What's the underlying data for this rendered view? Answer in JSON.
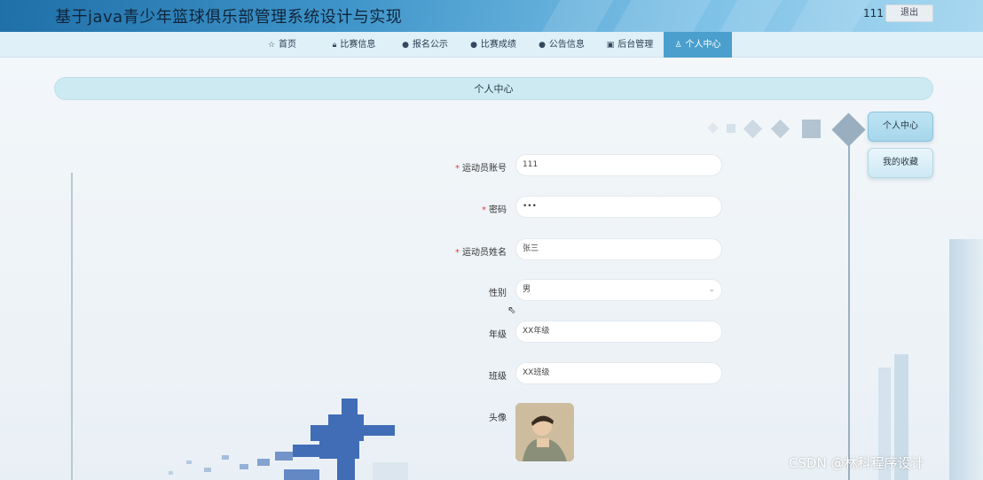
{
  "header": {
    "title": "基于java青少年篮球俱乐部管理系统设计与实现",
    "username": "111",
    "logout_label": "退出"
  },
  "nav": {
    "items": [
      {
        "label": "首页",
        "icon": "star-icon"
      },
      {
        "label": "比赛信息",
        "icon": "lock-icon"
      },
      {
        "label": "报名公示",
        "icon": "info-icon"
      },
      {
        "label": "比赛成绩",
        "icon": "question-icon"
      },
      {
        "label": "公告信息",
        "icon": "info-icon"
      },
      {
        "label": "后台管理",
        "icon": "briefcase-icon"
      },
      {
        "label": "个人中心",
        "icon": "user-icon"
      }
    ],
    "active": "个人中心"
  },
  "page": {
    "title": "个人中心"
  },
  "side_menu": {
    "items": [
      "个人中心",
      "我的收藏"
    ],
    "active": "个人中心"
  },
  "form": {
    "account_label": "运动员账号",
    "account_value": "111",
    "password_label": "密码",
    "password_value": "•••",
    "name_label": "运动员姓名",
    "name_value": "张三",
    "gender_label": "性别",
    "gender_value": "男",
    "grade_label": "年级",
    "grade_value": "XX年级",
    "class_label": "班级",
    "class_value": "XX班级",
    "avatar_label": "头像",
    "required_mark": "*"
  },
  "watermark": "CSDN @林科程序设计",
  "colors": {
    "accent": "#4b9fcc",
    "banner": "#cdeaf3",
    "required": "#e4393c"
  }
}
